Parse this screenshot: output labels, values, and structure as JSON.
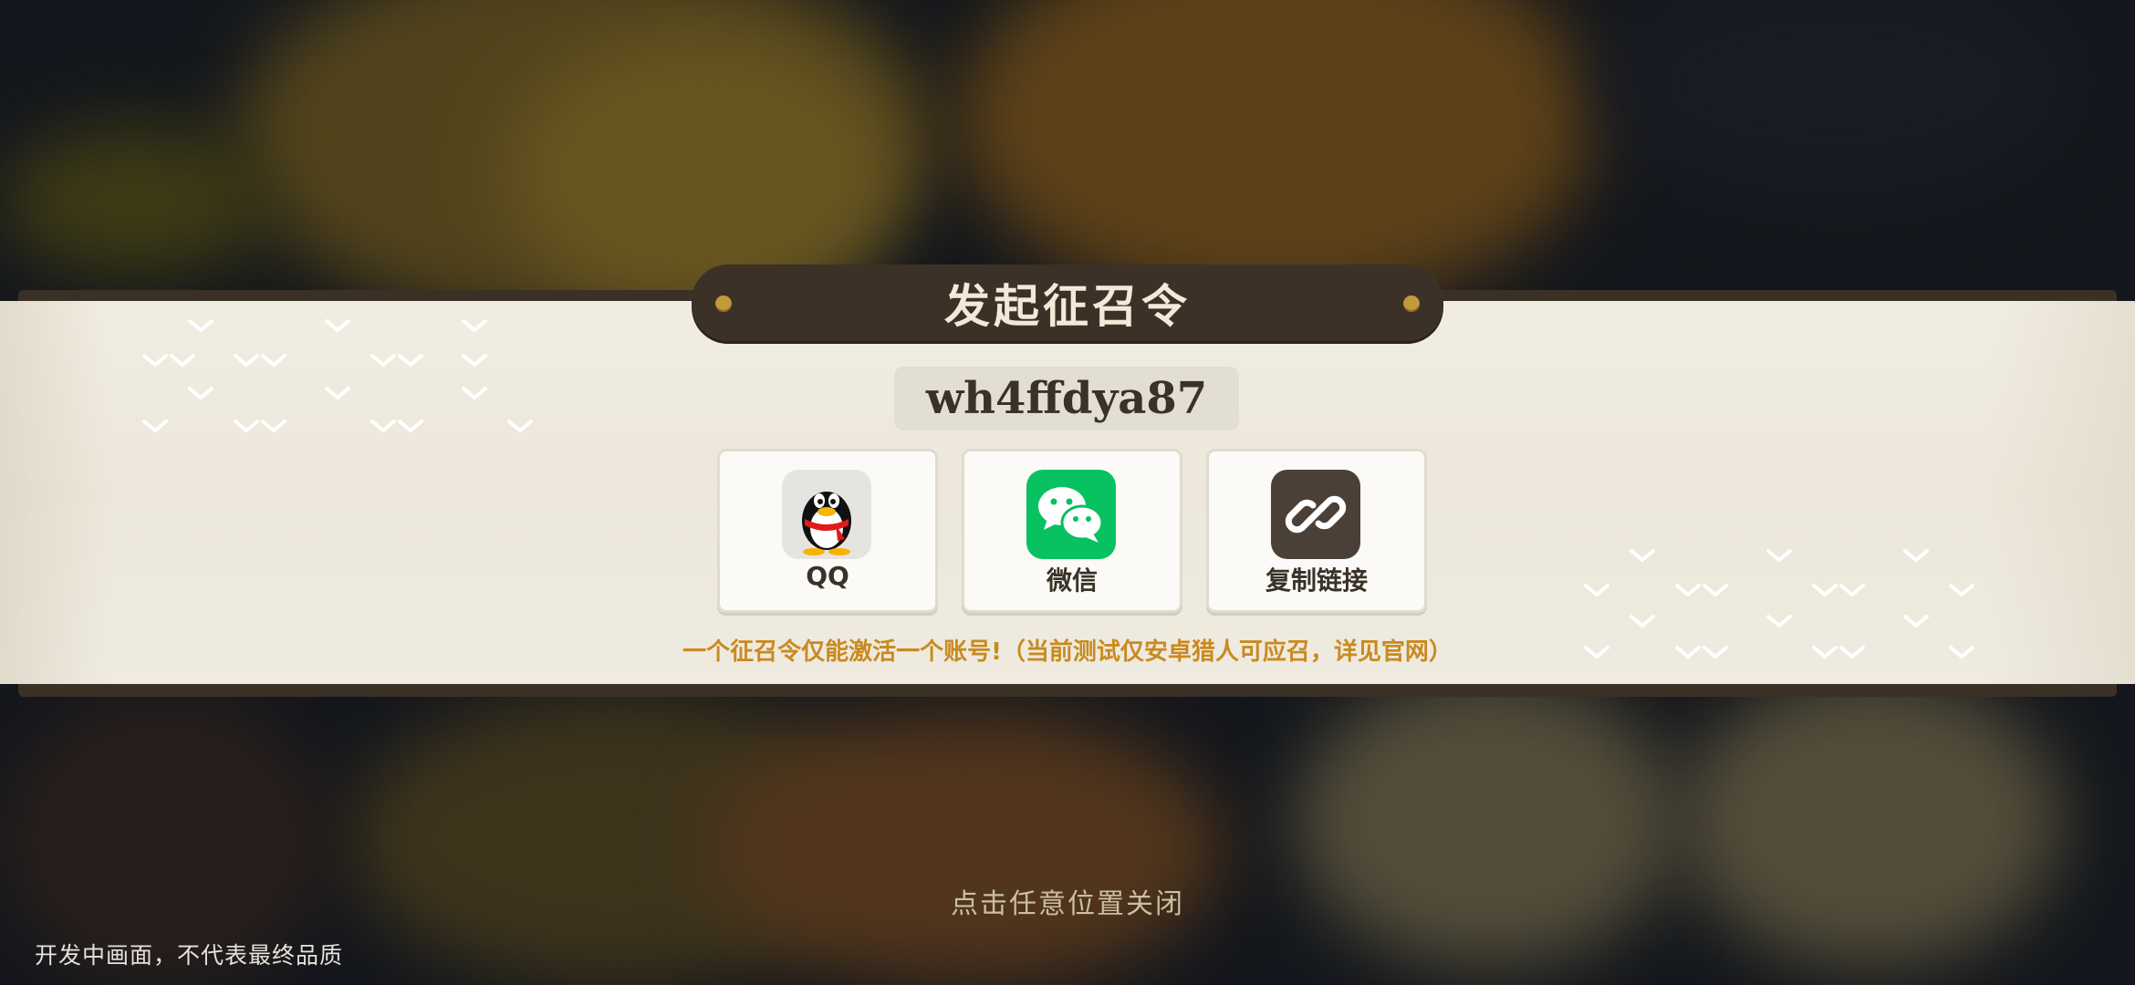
{
  "modal": {
    "title": "发起征召令",
    "code": "wh4ffdya87",
    "share_options": [
      {
        "label": "QQ",
        "icon": "qq-penguin-icon"
      },
      {
        "label": "微信",
        "icon": "wechat-icon"
      },
      {
        "label": "复制链接",
        "icon": "link-icon"
      }
    ],
    "notice": "一个征召令仅能激活一个账号!（当前测试仅安卓猎人可应召，详见官网）",
    "close_hint": "点击任意位置关闭"
  },
  "watermark": "开发中画面，不代表最终品质",
  "colors": {
    "band": "#ece7da",
    "plaque": "#3b3127",
    "notice": "#c98a1f",
    "wechat_green": "#08c160",
    "link_brown": "#4b4037"
  }
}
